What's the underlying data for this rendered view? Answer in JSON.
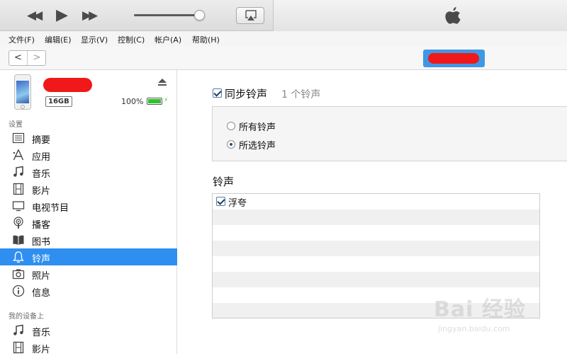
{
  "player": {
    "prev_glyph": "◀◀",
    "play_glyph": "▶",
    "next_glyph": "▶▶",
    "volume_level": 0.93,
    "airplay_icon": "airplay-icon",
    "logo_icon": "apple-logo-icon"
  },
  "menu": {
    "items": [
      "文件(F)",
      "编辑(E)",
      "显示(V)",
      "控制(C)",
      "帐户(A)",
      "帮助(H)"
    ]
  },
  "nav": {
    "back_glyph": "<",
    "forward_glyph": ">"
  },
  "device": {
    "capacity": "16GB",
    "battery_percent": "100%",
    "battery_level": 1.0,
    "battery_color": "#2ec22e"
  },
  "sidebar": {
    "settings_label": "设置",
    "settings_items": [
      {
        "label": "摘要",
        "icon": "summary-list-icon"
      },
      {
        "label": "应用",
        "icon": "apps-icon"
      },
      {
        "label": "音乐",
        "icon": "music-note-icon"
      },
      {
        "label": "影片",
        "icon": "film-icon"
      },
      {
        "label": "电视节目",
        "icon": "tv-icon"
      },
      {
        "label": "播客",
        "icon": "podcast-icon"
      },
      {
        "label": "图书",
        "icon": "book-icon"
      },
      {
        "label": "铃声",
        "icon": "bell-icon",
        "selected": true
      },
      {
        "label": "照片",
        "icon": "camera-icon"
      },
      {
        "label": "信息",
        "icon": "info-icon"
      }
    ],
    "my_device_label": "我的设备上",
    "device_items": [
      {
        "label": "音乐",
        "icon": "music-note-icon"
      },
      {
        "label": "影片",
        "icon": "film-icon"
      }
    ],
    "selected_color": "#2f8ff0"
  },
  "main": {
    "sync_label": "同步铃声",
    "sync_checked": true,
    "sync_count": "1 个铃声",
    "options": [
      {
        "label": "所有铃声",
        "selected": false
      },
      {
        "label": "所选铃声",
        "selected": true
      }
    ],
    "list_heading": "铃声",
    "ringtones": [
      {
        "label": "浮夸",
        "checked": true
      }
    ]
  },
  "watermark": {
    "main": "Bai 经验",
    "sub": "jingyan.baidu.com"
  }
}
